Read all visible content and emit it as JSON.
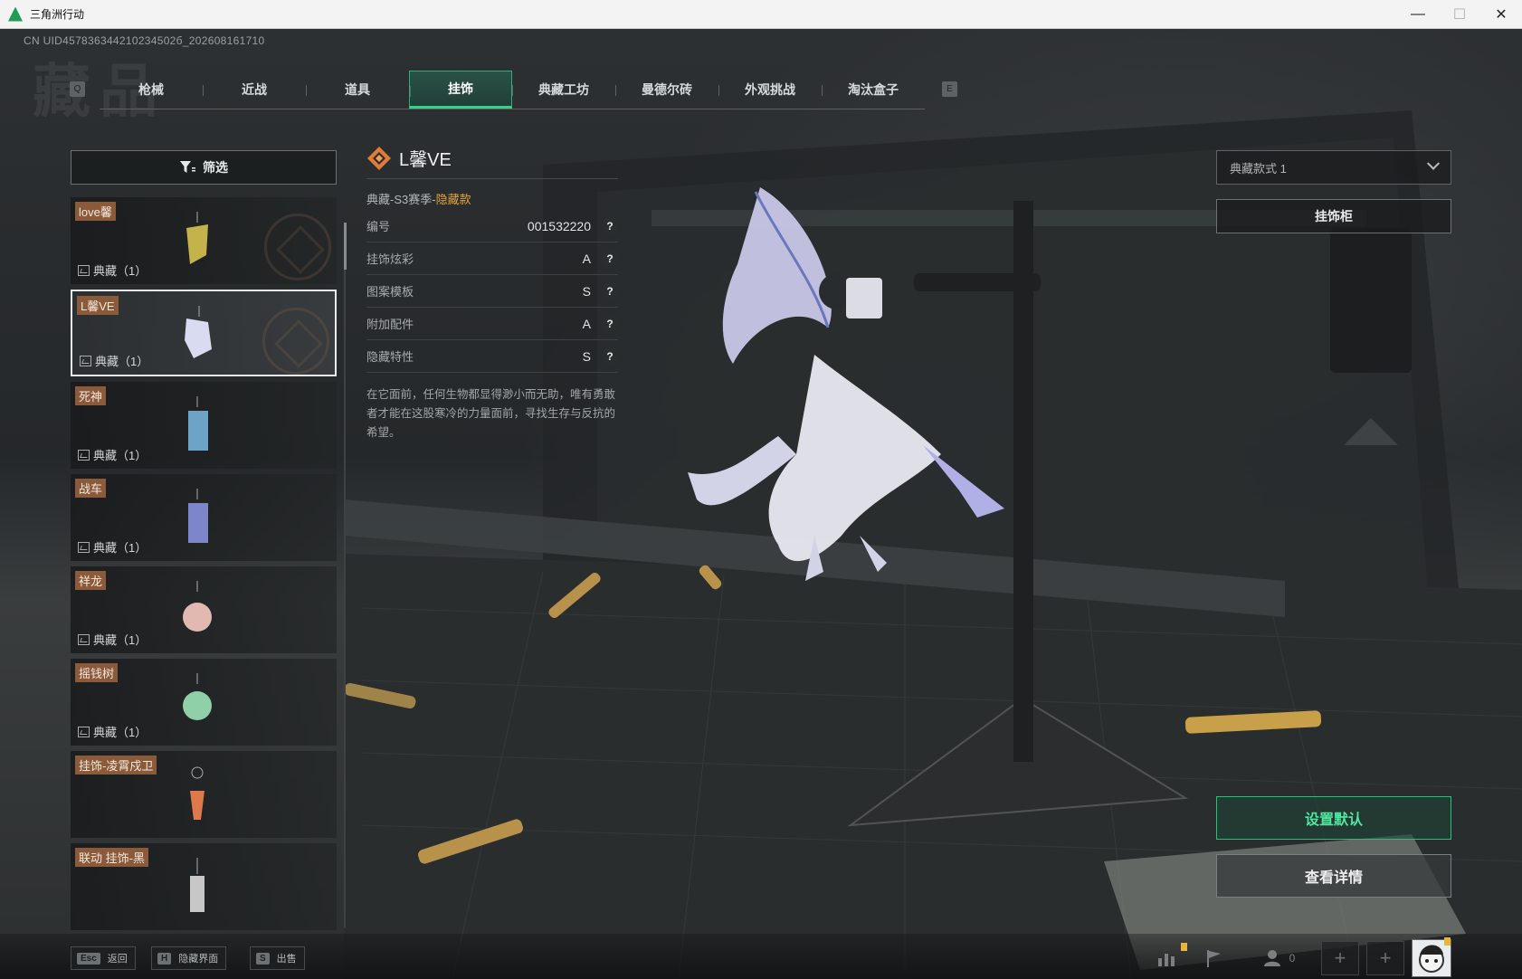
{
  "window": {
    "title": "三角洲行动",
    "controls": [
      "—",
      "☐",
      "✕"
    ]
  },
  "uid": "CN UID457836344210234502б_202608161710",
  "tabs": {
    "left_key": "Q",
    "right_key": "E",
    "items": [
      {
        "label": "枪械"
      },
      {
        "label": "近战"
      },
      {
        "label": "道具"
      },
      {
        "label": "挂饰",
        "active": true
      },
      {
        "label": "典藏工坊"
      },
      {
        "label": "曼德尔砖"
      },
      {
        "label": "外观挑战"
      },
      {
        "label": "淘汰盒子"
      }
    ]
  },
  "filter": {
    "label": "筛选"
  },
  "items": [
    {
      "name": "love馨",
      "count": "典藏（1）",
      "color": "#c4b24a"
    },
    {
      "name": "L馨VE",
      "count": "典藏（1）",
      "color": "#d9dbf0",
      "selected": true
    },
    {
      "name": "死神",
      "count": "典藏（1）",
      "color": "#6ea3c8"
    },
    {
      "name": "战车",
      "count": "典藏（1）",
      "color": "#7d86c9"
    },
    {
      "name": "祥龙",
      "count": "典藏（1）",
      "color": "#e2b9b0"
    },
    {
      "name": "摇钱树",
      "count": "典藏（1）",
      "color": "#8fd0a8"
    },
    {
      "name": "挂饰-凌霄戍卫",
      "count": "",
      "color": "#e0794a"
    },
    {
      "name": "联动 挂饰-黑",
      "count": "",
      "color": "#c7c7c7"
    }
  ],
  "detail": {
    "name": "L馨VE",
    "subtitle_prefix": "典藏-S3赛季-",
    "subtitle_tag": "隐藏款",
    "props": [
      {
        "label": "编号",
        "value": "001532220"
      },
      {
        "label": "挂饰炫彩",
        "value": "A"
      },
      {
        "label": "图案模板",
        "value": "S"
      },
      {
        "label": "附加配件",
        "value": "A"
      },
      {
        "label": "隐藏特性",
        "value": "S"
      }
    ],
    "description": "在它面前，任何生物都显得渺小而无助，唯有勇敢者才能在这股寒冷的力量面前，寻找生存与反抗的希望。"
  },
  "right": {
    "style_select": "典藏款式 1",
    "cabinet_button": "挂饰柜",
    "set_default_button": "设置默认",
    "view_details_button": "查看详情"
  },
  "bottom": {
    "hints": [
      {
        "key": "Esc",
        "label": "返回"
      },
      {
        "key": "H",
        "label": "隐藏界面"
      },
      {
        "key": "S",
        "label": "出售"
      }
    ],
    "friends_count": "0"
  },
  "colors": {
    "accent": "#2bd68f",
    "tag_bg": "#8b5a3a",
    "hidden_tag": "#e0a53a"
  }
}
